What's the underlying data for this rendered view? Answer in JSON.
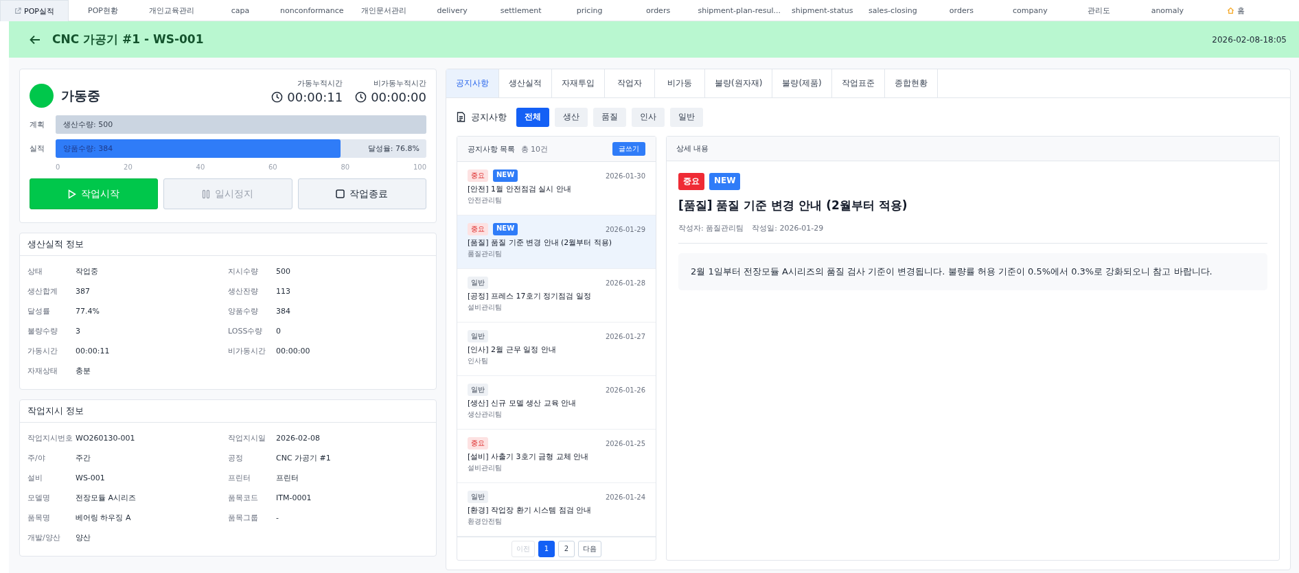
{
  "top_tabs": [
    {
      "label": "POP실적",
      "selected": true,
      "kind": "link"
    },
    {
      "label": "POP현황",
      "selected": false,
      "kind": "plain"
    },
    {
      "label": "개인교육관리",
      "selected": false,
      "kind": "plain"
    },
    {
      "label": "capa",
      "selected": false,
      "kind": "plain"
    },
    {
      "label": "nonconformance",
      "selected": false,
      "kind": "plain"
    },
    {
      "label": "개인문서관리",
      "selected": false,
      "kind": "plain"
    },
    {
      "label": "delivery",
      "selected": false,
      "kind": "plain"
    },
    {
      "label": "settlement",
      "selected": false,
      "kind": "plain"
    },
    {
      "label": "pricing",
      "selected": false,
      "kind": "plain"
    },
    {
      "label": "orders",
      "selected": false,
      "kind": "plain"
    },
    {
      "label": "shipment-plan-resul...",
      "selected": false,
      "kind": "plain"
    },
    {
      "label": "shipment-status",
      "selected": false,
      "kind": "plain"
    },
    {
      "label": "sales-closing",
      "selected": false,
      "kind": "plain"
    },
    {
      "label": "orders",
      "selected": false,
      "kind": "plain"
    },
    {
      "label": "company",
      "selected": false,
      "kind": "plain"
    },
    {
      "label": "관리도",
      "selected": false,
      "kind": "plain"
    },
    {
      "label": "anomaly",
      "selected": false,
      "kind": "plain"
    },
    {
      "label": "홈",
      "selected": false,
      "kind": "home"
    }
  ],
  "header": {
    "title": "CNC 가공기 #1 - WS-001",
    "datetime": "2026-02-08-18:05"
  },
  "status_card": {
    "status": {
      "label": "가동중",
      "running": true
    },
    "timers": [
      {
        "label": "가동누적시간",
        "value": "00:00:11"
      },
      {
        "label": "비가동누적시간",
        "value": "00:00:00"
      }
    ],
    "bars": [
      {
        "label": "계획",
        "text": "생산수량: 500",
        "level": 1,
        "kind": "plan"
      },
      {
        "label": "실적",
        "text": "양품수량: 384",
        "level": 0.768,
        "kind": "actual",
        "rate": "달성율: 76.8%"
      }
    ],
    "axis_ticks": [
      "0",
      "20",
      "40",
      "60",
      "80",
      "100"
    ],
    "buttons": [
      {
        "label": "작업시작",
        "kind": "start",
        "disabled": false
      },
      {
        "label": "일시정지",
        "kind": "pause",
        "disabled": true
      },
      {
        "label": "작업종료",
        "kind": "stop",
        "disabled": false
      }
    ]
  },
  "info_cards": [
    {
      "title": "생산실적 정보",
      "fields": [
        {
          "label": "상태",
          "value": "작업중"
        },
        {
          "label": "지시수량",
          "value": "500"
        },
        {
          "label": "생산합계",
          "value": "387"
        },
        {
          "label": "생산잔량",
          "value": "113"
        },
        {
          "label": "달성률",
          "value": "77.4%"
        },
        {
          "label": "양품수량",
          "value": "384"
        },
        {
          "label": "불량수량",
          "value": "3"
        },
        {
          "label": "LOSS수량",
          "value": "0"
        },
        {
          "label": "가동시간",
          "value": "00:00:11"
        },
        {
          "label": "비가동시간",
          "value": "00:00:00"
        },
        {
          "label": "자재상태",
          "value": "충분"
        }
      ]
    },
    {
      "title": "작업지시 정보",
      "fields": [
        {
          "label": "작업지시번호",
          "value": "WO260130-001"
        },
        {
          "label": "작업지시일",
          "value": "2026-02-08"
        },
        {
          "label": "주/야",
          "value": "주간"
        },
        {
          "label": "공정",
          "value": "CNC 가공기 #1"
        },
        {
          "label": "설비",
          "value": "WS-001"
        },
        {
          "label": "프린터",
          "value": "프린터"
        },
        {
          "label": "모델명",
          "value": "전장모듈 A시리즈"
        },
        {
          "label": "품목코드",
          "value": "ITM-0001"
        },
        {
          "label": "품목명",
          "value": "베어링 하우징 A"
        },
        {
          "label": "품목그룹",
          "value": "-"
        },
        {
          "label": "개발/양산",
          "value": "양산"
        }
      ]
    }
  ],
  "panel_tabs": [
    {
      "label": "공지사항",
      "selected": true
    },
    {
      "label": "생산실적",
      "selected": false
    },
    {
      "label": "자재투입",
      "selected": false
    },
    {
      "label": "작업자",
      "selected": false
    },
    {
      "label": "비가동",
      "selected": false
    },
    {
      "label": "불량(원자재)",
      "selected": false
    },
    {
      "label": "불량(제품)",
      "selected": false
    },
    {
      "label": "작업표준",
      "selected": false
    },
    {
      "label": "종합현황",
      "selected": false
    }
  ],
  "notice": {
    "heading": "공지사항",
    "filters": [
      {
        "label": "전체",
        "selected": true
      },
      {
        "label": "생산",
        "selected": false
      },
      {
        "label": "품질",
        "selected": false
      },
      {
        "label": "인사",
        "selected": false
      },
      {
        "label": "일반",
        "selected": false
      }
    ],
    "list": {
      "title": "공지사항 목록",
      "count": "총 10건",
      "write_button": "글쓰기",
      "items": [
        {
          "tags": [
            {
              "label": "중요",
              "kind": "important"
            },
            {
              "label": "NEW",
              "kind": "new"
            }
          ],
          "date": "2026-01-30",
          "title": "[안전] 1월 안전점검 실시 안내",
          "team": "안전관리팀",
          "selected": false
        },
        {
          "tags": [
            {
              "label": "중요",
              "kind": "important"
            },
            {
              "label": "NEW",
              "kind": "new"
            }
          ],
          "date": "2026-01-29",
          "title": "[품질] 품질 기준 변경 안내 (2월부터 적용)",
          "team": "품질관리팀",
          "selected": true
        },
        {
          "tags": [
            {
              "label": "일반",
              "kind": "normal"
            }
          ],
          "date": "2026-01-28",
          "title": "[공정] 프레스 17호기 정기점검 일정",
          "team": "설비관리팀",
          "selected": false
        },
        {
          "tags": [
            {
              "label": "일반",
              "kind": "normal"
            }
          ],
          "date": "2026-01-27",
          "title": "[인사] 2월 근무 일정 안내",
          "team": "인사팀",
          "selected": false
        },
        {
          "tags": [
            {
              "label": "일반",
              "kind": "normal"
            }
          ],
          "date": "2026-01-26",
          "title": "[생산] 신규 모델 생산 교육 안내",
          "team": "생산관리팀",
          "selected": false
        },
        {
          "tags": [
            {
              "label": "중요",
              "kind": "important"
            }
          ],
          "date": "2026-01-25",
          "title": "[설비] 사출기 3호기 금형 교체 안내",
          "team": "설비관리팀",
          "selected": false
        },
        {
          "tags": [
            {
              "label": "일반",
              "kind": "normal"
            }
          ],
          "date": "2026-01-24",
          "title": "[환경] 작업장 환기 시스템 점검 안내",
          "team": "환경안전팀",
          "selected": false
        }
      ],
      "pagination": [
        {
          "label": "이전",
          "selected": false,
          "disabled": true
        },
        {
          "label": "1",
          "selected": true,
          "disabled": false
        },
        {
          "label": "2",
          "selected": false,
          "disabled": false
        },
        {
          "label": "다음",
          "selected": false,
          "disabled": false
        }
      ]
    },
    "detail": {
      "title": "상세 내용",
      "tags": [
        {
          "label": "중요",
          "kind": "important"
        },
        {
          "label": "NEW",
          "kind": "new"
        }
      ],
      "heading": "[품질] 품질 기준 변경 안내 (2월부터 적용)",
      "author": "작성자: 품질관리팀",
      "date": "작성일: 2026-01-29",
      "body": "2월 1일부터 전장모듈 A시리즈의 품질 검사 기준이 변경됩니다. 불량률 허용 기준이 0.5%에서 0.3%로 강화되오니 참고 바랍니다."
    }
  }
}
